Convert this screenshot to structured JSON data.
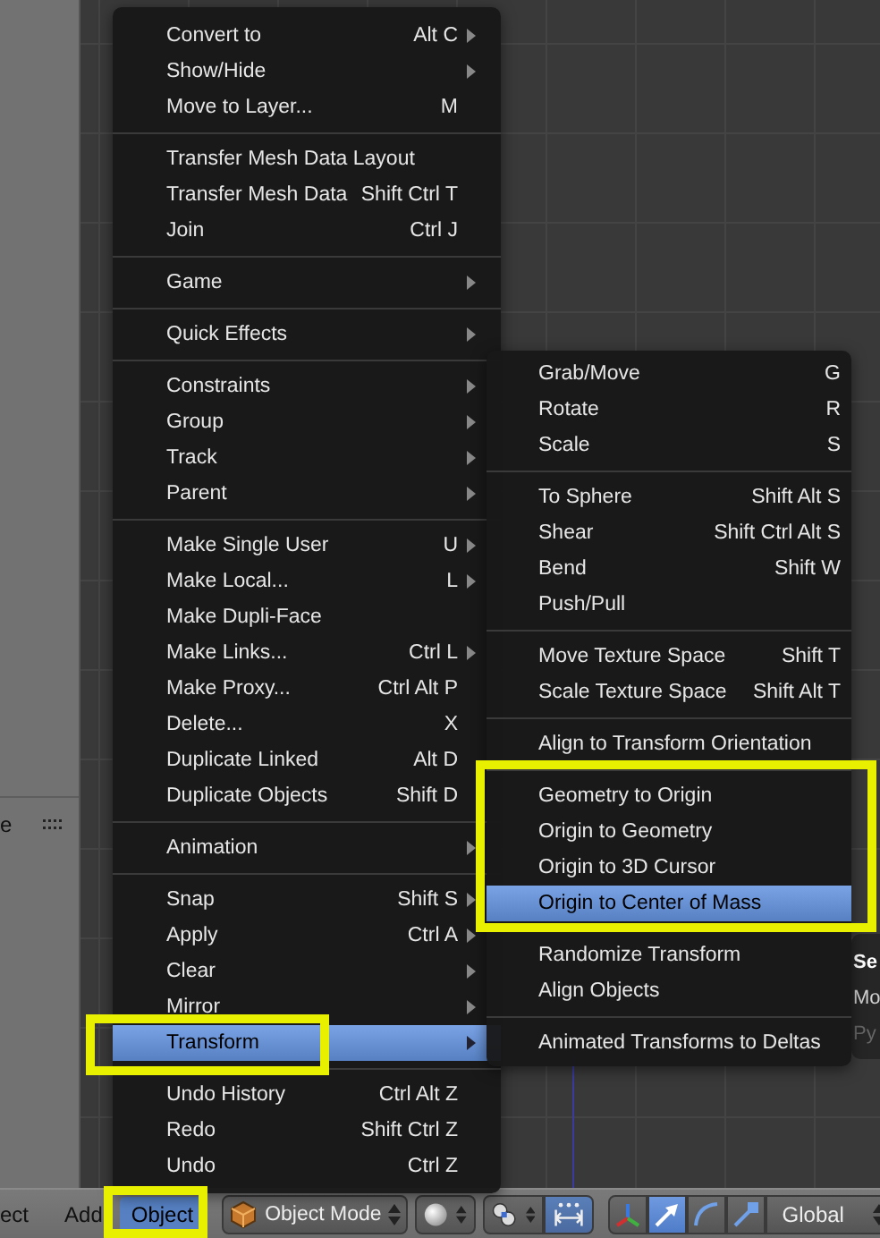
{
  "main_menu": {
    "sections": [
      [
        {
          "label": "Convert to",
          "shortcut": "Alt C",
          "submenu": true,
          "selected": false
        },
        {
          "label": "Show/Hide",
          "submenu": true,
          "selected": false
        },
        {
          "label": "Move to Layer...",
          "shortcut": "M",
          "submenu": false,
          "selected": false
        }
      ],
      [
        {
          "label": "Transfer Mesh Data Layout",
          "submenu": false,
          "selected": false
        },
        {
          "label": "Transfer Mesh Data",
          "shortcut": "Shift Ctrl T",
          "submenu": false,
          "selected": false
        },
        {
          "label": "Join",
          "shortcut": "Ctrl J",
          "submenu": false,
          "selected": false
        }
      ],
      [
        {
          "label": "Game",
          "submenu": true,
          "selected": false
        }
      ],
      [
        {
          "label": "Quick Effects",
          "submenu": true,
          "selected": false
        }
      ],
      [
        {
          "label": "Constraints",
          "submenu": true,
          "selected": false
        },
        {
          "label": "Group",
          "submenu": true,
          "selected": false
        },
        {
          "label": "Track",
          "submenu": true,
          "selected": false
        },
        {
          "label": "Parent",
          "submenu": true,
          "selected": false
        }
      ],
      [
        {
          "label": "Make Single User",
          "shortcut": "U",
          "submenu": true,
          "selected": false
        },
        {
          "label": "Make Local...",
          "shortcut": "L",
          "submenu": true,
          "selected": false
        },
        {
          "label": "Make Dupli-Face",
          "submenu": false,
          "selected": false
        },
        {
          "label": "Make Links...",
          "shortcut": "Ctrl L",
          "submenu": true,
          "selected": false
        },
        {
          "label": "Make Proxy...",
          "shortcut": "Ctrl Alt P",
          "submenu": false,
          "selected": false
        },
        {
          "label": "Delete...",
          "shortcut": "X",
          "submenu": false,
          "selected": false
        },
        {
          "label": "Duplicate Linked",
          "shortcut": "Alt D",
          "submenu": false,
          "selected": false
        },
        {
          "label": "Duplicate Objects",
          "shortcut": "Shift D",
          "submenu": false,
          "selected": false
        }
      ],
      [
        {
          "label": "Animation",
          "submenu": true,
          "selected": false
        }
      ],
      [
        {
          "label": "Snap",
          "shortcut": "Shift S",
          "submenu": true,
          "selected": false
        },
        {
          "label": "Apply",
          "shortcut": "Ctrl A",
          "submenu": true,
          "selected": false
        },
        {
          "label": "Clear",
          "submenu": true,
          "selected": false
        },
        {
          "label": "Mirror",
          "submenu": true,
          "selected": false
        },
        {
          "label": "Transform",
          "submenu": true,
          "selected": true
        }
      ],
      [
        {
          "label": "Undo History",
          "shortcut": "Ctrl Alt Z",
          "submenu": false,
          "selected": false
        },
        {
          "label": "Redo",
          "shortcut": "Shift Ctrl Z",
          "submenu": false,
          "selected": false
        },
        {
          "label": "Undo",
          "shortcut": "Ctrl Z",
          "submenu": false,
          "selected": false
        }
      ]
    ]
  },
  "transform_submenu": {
    "sections": [
      [
        {
          "label": "Grab/Move",
          "shortcut": "G",
          "selected": false
        },
        {
          "label": "Rotate",
          "shortcut": "R",
          "selected": false
        },
        {
          "label": "Scale",
          "shortcut": "S",
          "selected": false
        }
      ],
      [
        {
          "label": "To Sphere",
          "shortcut": "Shift Alt S",
          "selected": false
        },
        {
          "label": "Shear",
          "shortcut": "Shift Ctrl Alt S",
          "selected": false
        },
        {
          "label": "Bend",
          "shortcut": "Shift W",
          "selected": false
        },
        {
          "label": "Push/Pull",
          "selected": false
        }
      ],
      [
        {
          "label": "Move Texture Space",
          "shortcut": "Shift T",
          "selected": false
        },
        {
          "label": "Scale Texture Space",
          "shortcut": "Shift Alt T",
          "selected": false
        }
      ],
      [
        {
          "label": "Align to Transform Orientation",
          "selected": false
        }
      ],
      [
        {
          "label": "Geometry to Origin",
          "selected": false
        },
        {
          "label": "Origin to Geometry",
          "selected": false
        },
        {
          "label": "Origin to 3D Cursor",
          "selected": false
        },
        {
          "label": "Origin to Center of Mass",
          "selected": true
        }
      ],
      [
        {
          "label": "Randomize Transform",
          "selected": false
        },
        {
          "label": "Align Objects",
          "selected": false
        }
      ],
      [
        {
          "label": "Animated Transforms to Deltas",
          "selected": false
        }
      ]
    ]
  },
  "background_menu": {
    "items": [
      {
        "label": "Se",
        "disabled": false
      },
      {
        "label": "Mo",
        "disabled": false
      },
      {
        "label": "Py",
        "disabled": true
      }
    ]
  },
  "side_panel": {
    "label": "e"
  },
  "header": {
    "menus": [
      {
        "label": "ect",
        "selected": false
      },
      {
        "label": "Add",
        "selected": false
      },
      {
        "label": "Object",
        "selected": true
      }
    ],
    "mode": "Object Mode",
    "orientation": "Global",
    "manipulators": [
      {
        "kind": "axes",
        "selected": false
      },
      {
        "kind": "translate",
        "selected": true
      },
      {
        "kind": "rotate",
        "selected": false
      },
      {
        "kind": "scale",
        "selected": false
      }
    ]
  }
}
